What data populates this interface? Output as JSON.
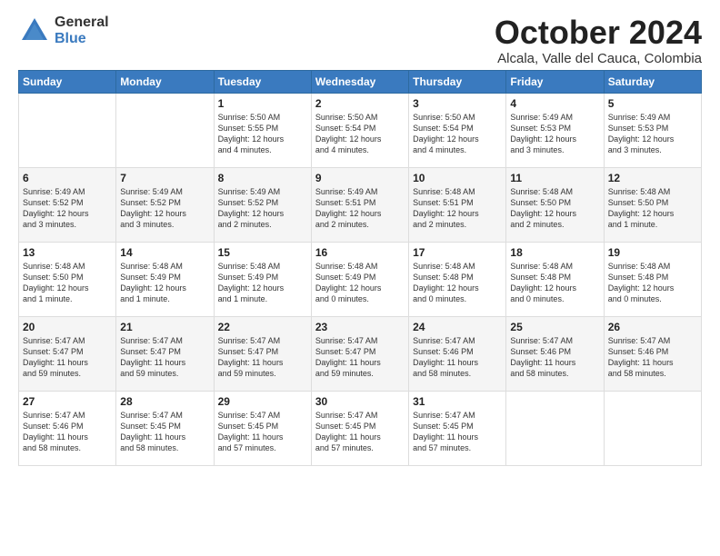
{
  "logo": {
    "general": "General",
    "blue": "Blue"
  },
  "title": "October 2024",
  "subtitle": "Alcala, Valle del Cauca, Colombia",
  "days": [
    "Sunday",
    "Monday",
    "Tuesday",
    "Wednesday",
    "Thursday",
    "Friday",
    "Saturday"
  ],
  "weeks": [
    [
      {
        "day": "",
        "content": ""
      },
      {
        "day": "",
        "content": ""
      },
      {
        "day": "1",
        "content": "Sunrise: 5:50 AM\nSunset: 5:55 PM\nDaylight: 12 hours\nand 4 minutes."
      },
      {
        "day": "2",
        "content": "Sunrise: 5:50 AM\nSunset: 5:54 PM\nDaylight: 12 hours\nand 4 minutes."
      },
      {
        "day": "3",
        "content": "Sunrise: 5:50 AM\nSunset: 5:54 PM\nDaylight: 12 hours\nand 4 minutes."
      },
      {
        "day": "4",
        "content": "Sunrise: 5:49 AM\nSunset: 5:53 PM\nDaylight: 12 hours\nand 3 minutes."
      },
      {
        "day": "5",
        "content": "Sunrise: 5:49 AM\nSunset: 5:53 PM\nDaylight: 12 hours\nand 3 minutes."
      }
    ],
    [
      {
        "day": "6",
        "content": "Sunrise: 5:49 AM\nSunset: 5:52 PM\nDaylight: 12 hours\nand 3 minutes."
      },
      {
        "day": "7",
        "content": "Sunrise: 5:49 AM\nSunset: 5:52 PM\nDaylight: 12 hours\nand 3 minutes."
      },
      {
        "day": "8",
        "content": "Sunrise: 5:49 AM\nSunset: 5:52 PM\nDaylight: 12 hours\nand 2 minutes."
      },
      {
        "day": "9",
        "content": "Sunrise: 5:49 AM\nSunset: 5:51 PM\nDaylight: 12 hours\nand 2 minutes."
      },
      {
        "day": "10",
        "content": "Sunrise: 5:48 AM\nSunset: 5:51 PM\nDaylight: 12 hours\nand 2 minutes."
      },
      {
        "day": "11",
        "content": "Sunrise: 5:48 AM\nSunset: 5:50 PM\nDaylight: 12 hours\nand 2 minutes."
      },
      {
        "day": "12",
        "content": "Sunrise: 5:48 AM\nSunset: 5:50 PM\nDaylight: 12 hours\nand 1 minute."
      }
    ],
    [
      {
        "day": "13",
        "content": "Sunrise: 5:48 AM\nSunset: 5:50 PM\nDaylight: 12 hours\nand 1 minute."
      },
      {
        "day": "14",
        "content": "Sunrise: 5:48 AM\nSunset: 5:49 PM\nDaylight: 12 hours\nand 1 minute."
      },
      {
        "day": "15",
        "content": "Sunrise: 5:48 AM\nSunset: 5:49 PM\nDaylight: 12 hours\nand 1 minute."
      },
      {
        "day": "16",
        "content": "Sunrise: 5:48 AM\nSunset: 5:49 PM\nDaylight: 12 hours\nand 0 minutes."
      },
      {
        "day": "17",
        "content": "Sunrise: 5:48 AM\nSunset: 5:48 PM\nDaylight: 12 hours\nand 0 minutes."
      },
      {
        "day": "18",
        "content": "Sunrise: 5:48 AM\nSunset: 5:48 PM\nDaylight: 12 hours\nand 0 minutes."
      },
      {
        "day": "19",
        "content": "Sunrise: 5:48 AM\nSunset: 5:48 PM\nDaylight: 12 hours\nand 0 minutes."
      }
    ],
    [
      {
        "day": "20",
        "content": "Sunrise: 5:47 AM\nSunset: 5:47 PM\nDaylight: 11 hours\nand 59 minutes."
      },
      {
        "day": "21",
        "content": "Sunrise: 5:47 AM\nSunset: 5:47 PM\nDaylight: 11 hours\nand 59 minutes."
      },
      {
        "day": "22",
        "content": "Sunrise: 5:47 AM\nSunset: 5:47 PM\nDaylight: 11 hours\nand 59 minutes."
      },
      {
        "day": "23",
        "content": "Sunrise: 5:47 AM\nSunset: 5:47 PM\nDaylight: 11 hours\nand 59 minutes."
      },
      {
        "day": "24",
        "content": "Sunrise: 5:47 AM\nSunset: 5:46 PM\nDaylight: 11 hours\nand 58 minutes."
      },
      {
        "day": "25",
        "content": "Sunrise: 5:47 AM\nSunset: 5:46 PM\nDaylight: 11 hours\nand 58 minutes."
      },
      {
        "day": "26",
        "content": "Sunrise: 5:47 AM\nSunset: 5:46 PM\nDaylight: 11 hours\nand 58 minutes."
      }
    ],
    [
      {
        "day": "27",
        "content": "Sunrise: 5:47 AM\nSunset: 5:46 PM\nDaylight: 11 hours\nand 58 minutes."
      },
      {
        "day": "28",
        "content": "Sunrise: 5:47 AM\nSunset: 5:45 PM\nDaylight: 11 hours\nand 58 minutes."
      },
      {
        "day": "29",
        "content": "Sunrise: 5:47 AM\nSunset: 5:45 PM\nDaylight: 11 hours\nand 57 minutes."
      },
      {
        "day": "30",
        "content": "Sunrise: 5:47 AM\nSunset: 5:45 PM\nDaylight: 11 hours\nand 57 minutes."
      },
      {
        "day": "31",
        "content": "Sunrise: 5:47 AM\nSunset: 5:45 PM\nDaylight: 11 hours\nand 57 minutes."
      },
      {
        "day": "",
        "content": ""
      },
      {
        "day": "",
        "content": ""
      }
    ]
  ]
}
